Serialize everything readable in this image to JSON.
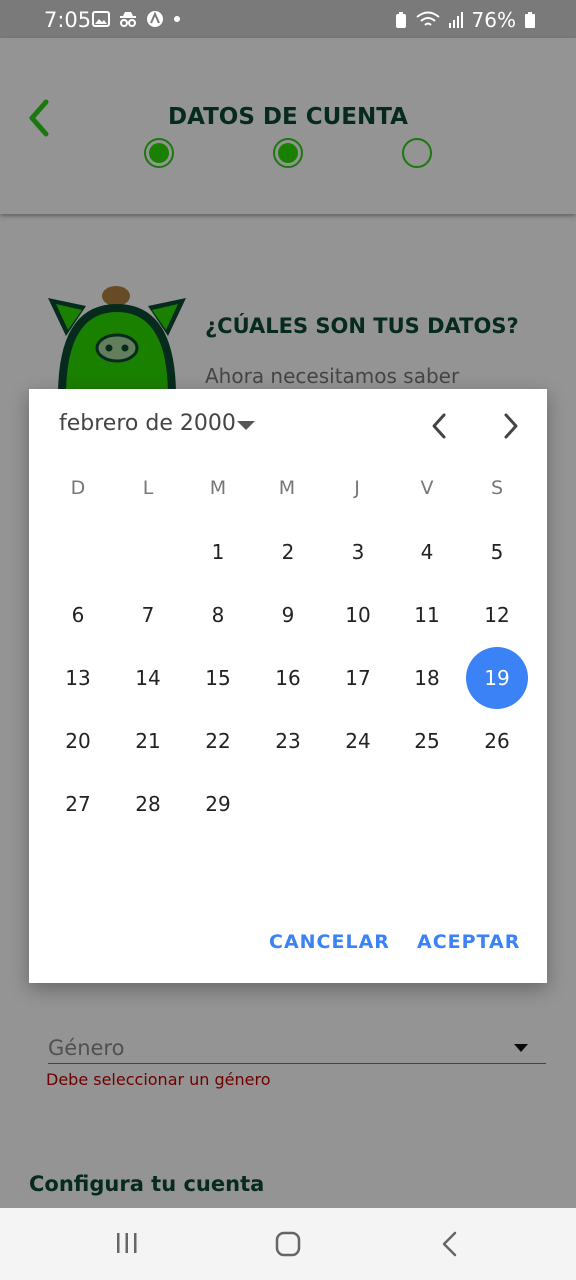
{
  "status_bar": {
    "time": "7:05",
    "battery": "76%"
  },
  "header": {
    "title": "DATOS DE CUENTA",
    "steps": [
      "complete",
      "complete",
      "pending"
    ]
  },
  "content": {
    "title": "¿CÚALES SON TUS DATOS?",
    "subtitle": "Ahora necesitamos saber",
    "gender_placeholder": "Género",
    "gender_error": "Debe seleccionar un género",
    "section_title": "Configura tu cuenta"
  },
  "date_picker": {
    "month_label": "febrero de 2000",
    "weekdays": [
      "D",
      "L",
      "M",
      "M",
      "J",
      "V",
      "S"
    ],
    "days": [
      "1",
      "2",
      "3",
      "4",
      "5",
      "6",
      "7",
      "8",
      "9",
      "10",
      "11",
      "12",
      "13",
      "14",
      "15",
      "16",
      "17",
      "18",
      "19",
      "20",
      "21",
      "22",
      "23",
      "24",
      "25",
      "26",
      "27",
      "28",
      "29"
    ],
    "selected_day": "19",
    "cancel_label": "CANCELAR",
    "accept_label": "ACEPTAR"
  },
  "colors": {
    "accent_green": "#2edc00",
    "dark_green": "#0c4a33",
    "picker_blue": "#3b82f6",
    "error_red": "#c00000"
  }
}
